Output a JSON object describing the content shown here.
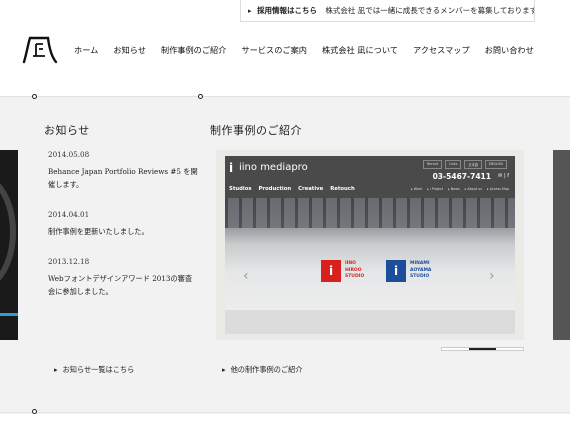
{
  "header": {
    "recruit_link": "採用情報はこちら",
    "recruit_text": "株式会社 凪では一緒に成長できるメンバーを募集しております。",
    "nav": [
      "ホーム",
      "お知らせ",
      "制作事例のご紹介",
      "サービスのご案内",
      "株式会社 凪について",
      "アクセスマップ",
      "お問い合わせ"
    ]
  },
  "news": {
    "title": "お知らせ",
    "items": [
      {
        "date": "2014.05.08",
        "text": "Behance Japan Portfolio Reviews #5 を開催します。"
      },
      {
        "date": "2014.04.01",
        "text": "制作事例を更新いたしました。"
      },
      {
        "date": "2013.12.18",
        "text": "Webフォントデザインアワード 2013の審査会に参加しました。"
      }
    ],
    "more_link": "お知らせ一覧はこちら"
  },
  "works": {
    "title": "制作事例のご紹介",
    "more_link": "他の制作事例のご紹介",
    "slide": {
      "logo_i": "i",
      "logo": "iino mediapro",
      "tabs": [
        "Recruit",
        "Links",
        "日本語",
        "ENGLISH"
      ],
      "tel": "03-5467-7411",
      "sns": "✉ | f",
      "menu": [
        "Studios",
        "Production",
        "Creative",
        "Retouch"
      ],
      "submenu": [
        "▸ Work",
        "▸ i Project",
        "▸ News",
        "▸ About us",
        "▸ Access Map"
      ],
      "studio_a": {
        "mark": "i",
        "text": [
          "IINO",
          "HIROO",
          "STUDIO"
        ]
      },
      "studio_b": {
        "mark": "i",
        "text": [
          "MINAMI",
          "AOYAMA",
          "STUDIO"
        ]
      },
      "prev": "‹",
      "next": "›"
    },
    "pager": {
      "count": 3,
      "active_index": 1
    }
  },
  "icons": {
    "recruit_arrow": "caret-right-icon",
    "link_arrow": "caret-right-icon",
    "logo": "nagi-logo"
  },
  "colors": {
    "band": "#f2f2f2",
    "studio_red": "#d9201f",
    "studio_blue": "#1c4e9c",
    "site_header": "#4a4a4a"
  }
}
